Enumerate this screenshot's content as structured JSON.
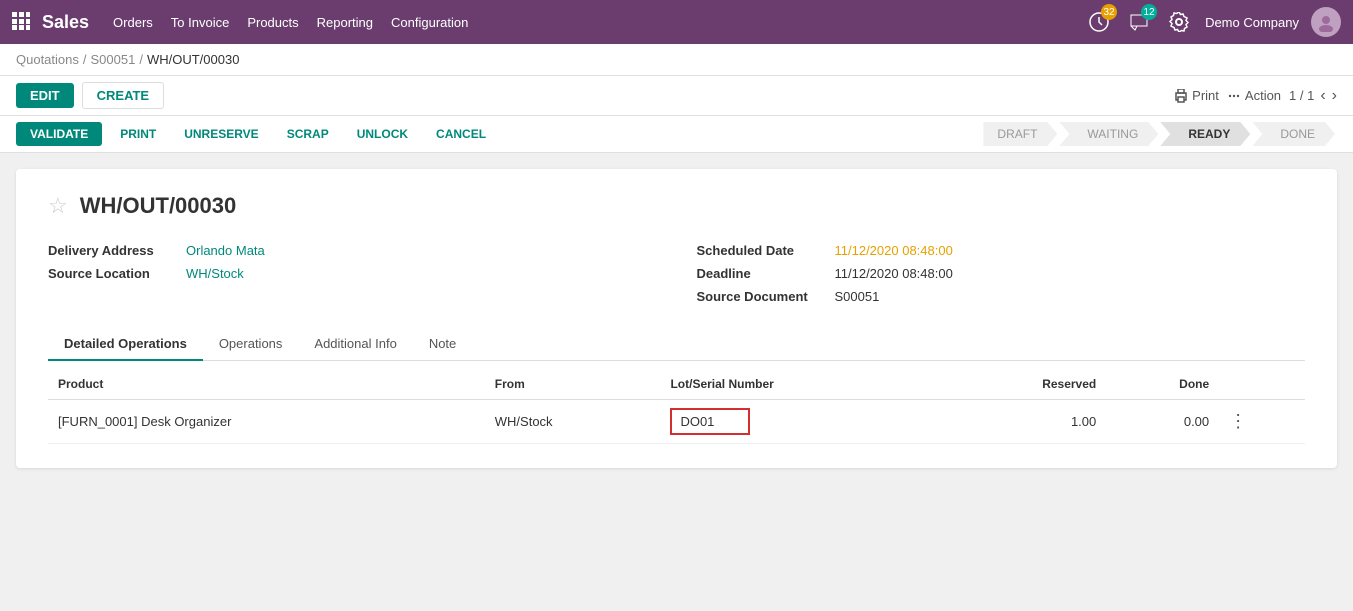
{
  "navbar": {
    "brand": "Sales",
    "menu": [
      "Orders",
      "To Invoice",
      "Products",
      "Reporting",
      "Configuration"
    ],
    "badge1_count": "32",
    "badge2_count": "12",
    "company": "Demo Company"
  },
  "breadcrumb": {
    "items": [
      "Quotations",
      "S00051",
      "WH/OUT/00030"
    ]
  },
  "action_bar": {
    "edit_label": "EDIT",
    "create_label": "CREATE",
    "print_label": "Print",
    "action_label": "Action",
    "pagination": "1 / 1"
  },
  "status_bar": {
    "validate_label": "VALIDATE",
    "print_label": "PRINT",
    "unreserve_label": "UNRESERVE",
    "scrap_label": "SCRAP",
    "unlock_label": "UNLOCK",
    "cancel_label": "CANCEL",
    "steps": [
      "DRAFT",
      "WAITING",
      "READY",
      "DONE"
    ]
  },
  "form": {
    "title": "WH/OUT/00030",
    "fields_left": {
      "delivery_address_label": "Delivery Address",
      "delivery_address_value": "Orlando Mata",
      "source_location_label": "Source Location",
      "source_location_value": "WH/Stock"
    },
    "fields_right": {
      "scheduled_date_label": "Scheduled Date",
      "scheduled_date_value": "11/12/2020 08:48:00",
      "deadline_label": "Deadline",
      "deadline_value": "11/12/2020 08:48:00",
      "source_doc_label": "Source Document",
      "source_doc_value": "S00051"
    }
  },
  "tabs": {
    "items": [
      "Detailed Operations",
      "Operations",
      "Additional Info",
      "Note"
    ],
    "active": 0
  },
  "table": {
    "headers": [
      "Product",
      "From",
      "Lot/Serial Number",
      "Reserved",
      "Done"
    ],
    "rows": [
      {
        "product": "[FURN_0001] Desk Organizer",
        "from": "WH/Stock",
        "lot_serial": "DO01",
        "reserved": "1.00",
        "done": "0.00"
      }
    ]
  }
}
